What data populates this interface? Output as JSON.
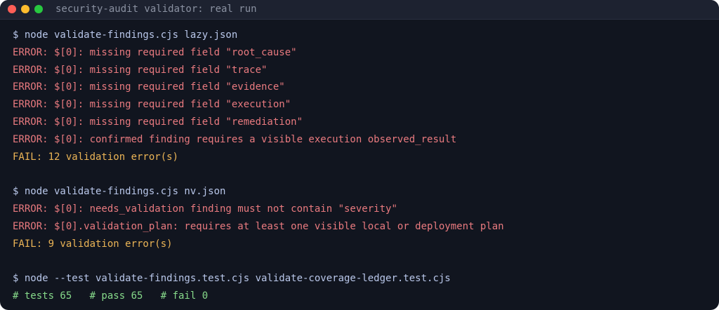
{
  "window": {
    "title": "security-audit validator: real run"
  },
  "terminal": {
    "lines": [
      {
        "kind": "cmd",
        "text": "$ node validate-findings.cjs lazy.json"
      },
      {
        "kind": "err",
        "text": "ERROR: $[0]: missing required field \"root_cause\""
      },
      {
        "kind": "err",
        "text": "ERROR: $[0]: missing required field \"trace\""
      },
      {
        "kind": "err",
        "text": "ERROR: $[0]: missing required field \"evidence\""
      },
      {
        "kind": "err",
        "text": "ERROR: $[0]: missing required field \"execution\""
      },
      {
        "kind": "err",
        "text": "ERROR: $[0]: missing required field \"remediation\""
      },
      {
        "kind": "err",
        "text": "ERROR: $[0]: confirmed finding requires a visible execution observed_result"
      },
      {
        "kind": "fail",
        "text": "FAIL: 12 validation error(s)"
      },
      {
        "kind": "blank",
        "text": ""
      },
      {
        "kind": "cmd",
        "text": "$ node validate-findings.cjs nv.json"
      },
      {
        "kind": "err",
        "text": "ERROR: $[0]: needs_validation finding must not contain \"severity\""
      },
      {
        "kind": "err",
        "text": "ERROR: $[0].validation_plan: requires at least one visible local or deployment plan"
      },
      {
        "kind": "fail",
        "text": "FAIL: 9 validation error(s)"
      },
      {
        "kind": "blank",
        "text": ""
      },
      {
        "kind": "cmd",
        "text": "$ node --test validate-findings.test.cjs validate-coverage-ledger.test.cjs"
      },
      {
        "kind": "pass",
        "text": "# tests 65   # pass 65   # fail 0"
      }
    ]
  }
}
